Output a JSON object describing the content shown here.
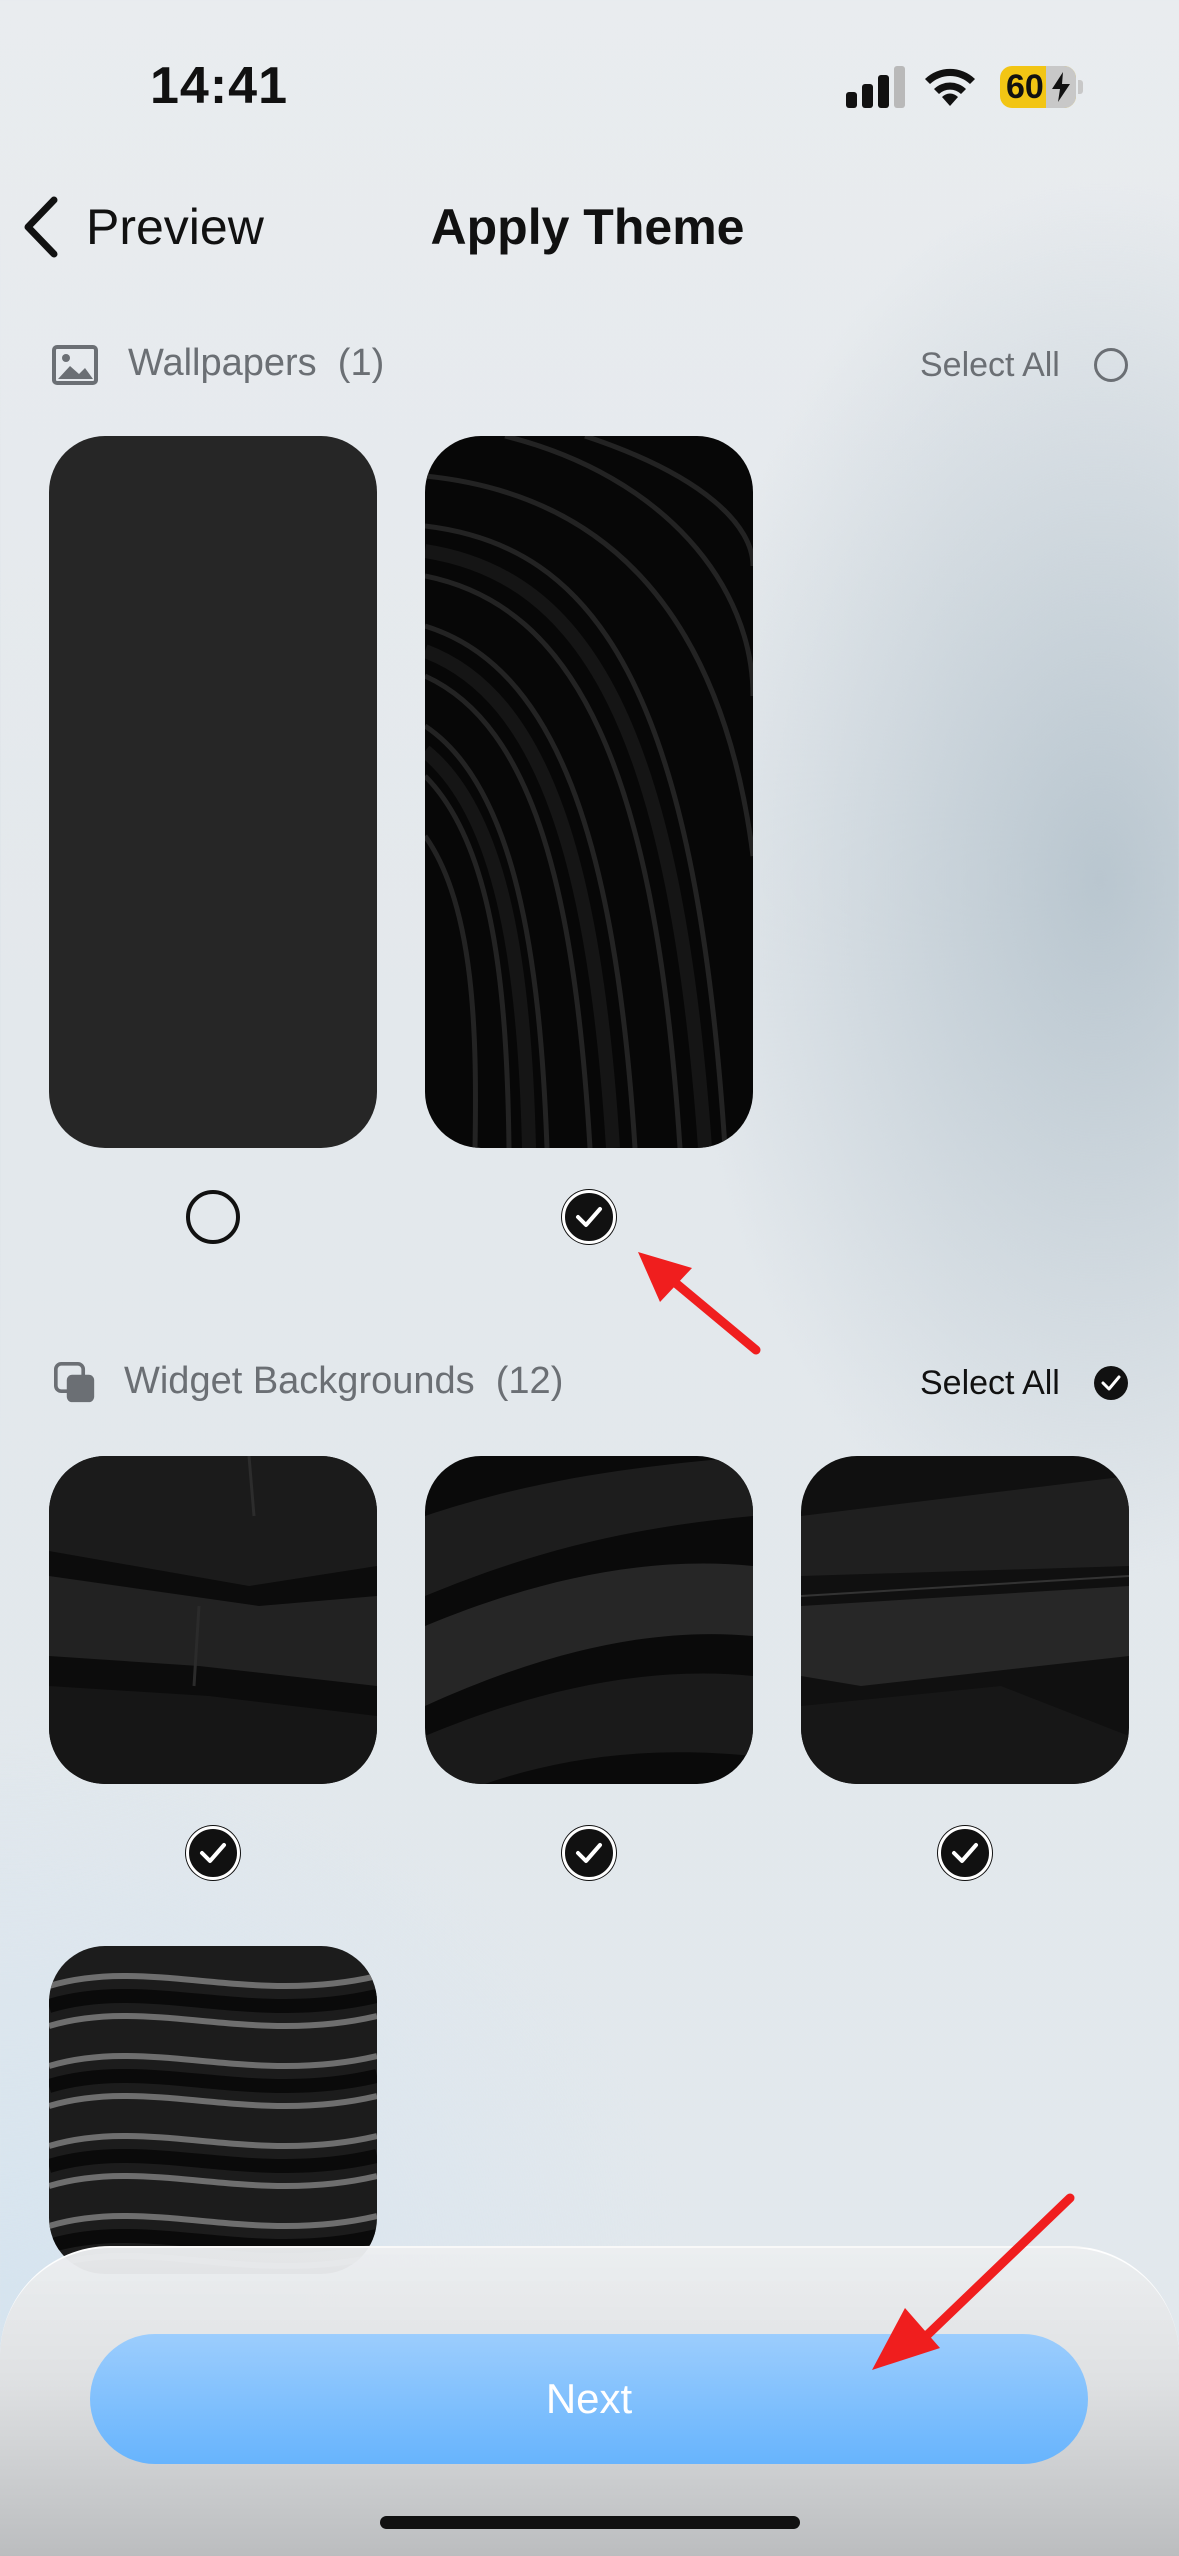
{
  "status_bar": {
    "time": "14:41",
    "battery": "60",
    "icons": [
      "cellular-signal-icon",
      "wifi-icon",
      "battery-charging-icon"
    ]
  },
  "nav": {
    "back_label": "Preview",
    "title": "Apply Theme"
  },
  "wallpapers": {
    "title": "Wallpapers",
    "count": "(1)",
    "select_all_label": "Select All",
    "select_all_checked": false,
    "items": [
      {
        "selected": false,
        "style": "solid dark gray"
      },
      {
        "selected": true,
        "style": "black curved ridges"
      }
    ]
  },
  "widget_backgrounds": {
    "title": "Widget Backgrounds",
    "count": "(12)",
    "select_all_label": "Select All",
    "select_all_checked": true,
    "items": [
      {
        "selected": true,
        "style": "black angular layers"
      },
      {
        "selected": true,
        "style": "black flowing bands"
      },
      {
        "selected": true,
        "style": "black folded planes"
      },
      {
        "selected": true,
        "style": "dark wavy stripes"
      }
    ]
  },
  "footer": {
    "next_label": "Next"
  },
  "colors": {
    "accent": "#67b4fd",
    "annotation_arrow": "#f01e1e",
    "text_primary": "#111111",
    "text_secondary": "#6b6f74"
  }
}
